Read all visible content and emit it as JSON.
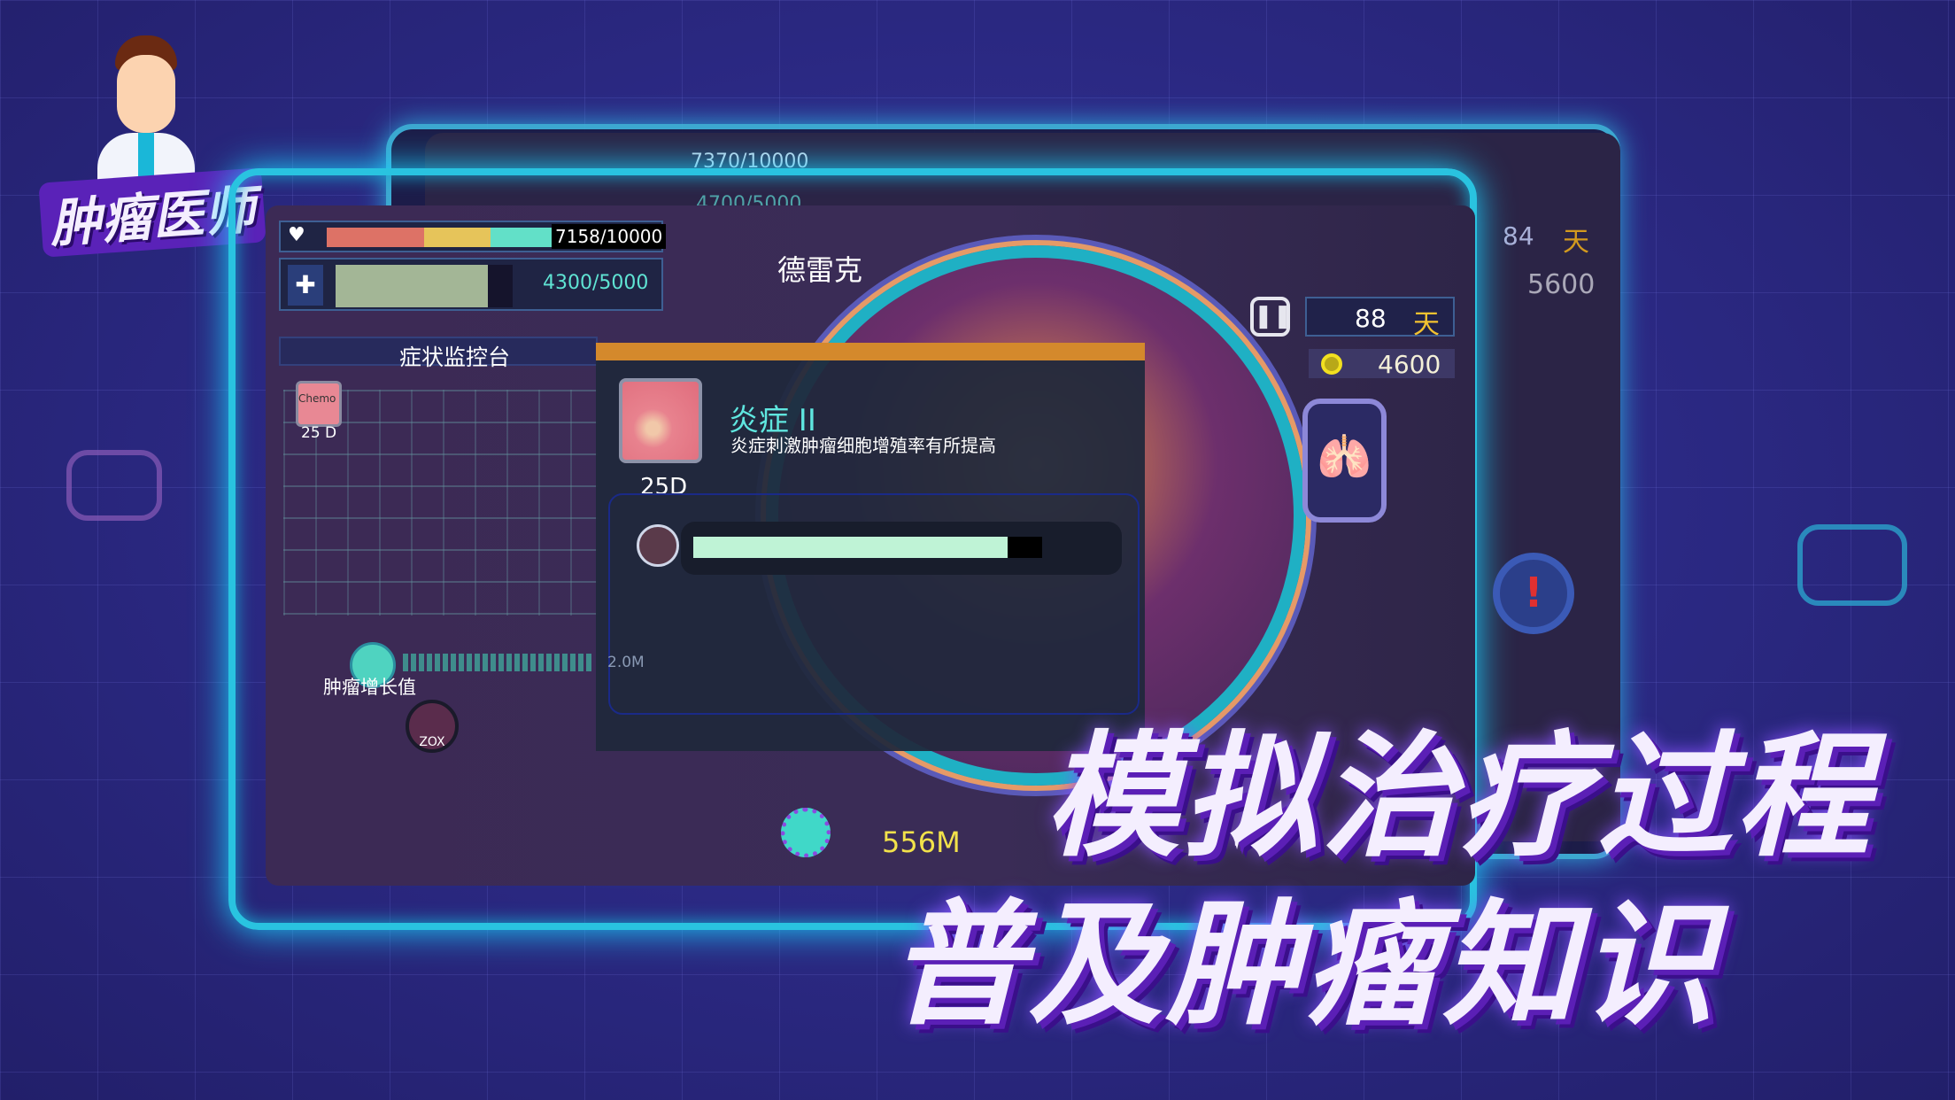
{
  "logo": {
    "title": "肿瘤医师"
  },
  "back_screen": {
    "health": "7370/10000",
    "shield": "4700/5000",
    "days": "84",
    "days_unit": "天",
    "coins": "5600"
  },
  "hud": {
    "health_text": "7158/10000",
    "health_segments": [
      {
        "color": "#dd7266"
      },
      {
        "color": "#e6c45a"
      },
      {
        "color": "#62e0c8"
      }
    ],
    "health_fraction": 0.7158,
    "shield_text": "4300/5000",
    "shield_fraction": 0.86,
    "patient_name": "德雷克",
    "days": "88",
    "days_unit": "天",
    "coins": "4600"
  },
  "monitor": {
    "title": "症状监控台",
    "chemo_label": "Chemo",
    "chemo_days": "25 D",
    "growth_label": "肿瘤增长值",
    "axis_label": "2.0M",
    "drug_label": "ZOX"
  },
  "popup": {
    "title": "炎症 II",
    "description": "炎症刺激肿瘤细胞增殖率有所提高",
    "duration": "25D",
    "progress_fraction": 0.9
  },
  "tumor": {
    "size": "556M"
  },
  "slogan": {
    "line1": "模拟治疗过程",
    "line2": "普及肿瘤知识"
  },
  "colors": {
    "accent": "#29c3e0",
    "gold": "#f2c230",
    "progress": "#bff3d6"
  }
}
